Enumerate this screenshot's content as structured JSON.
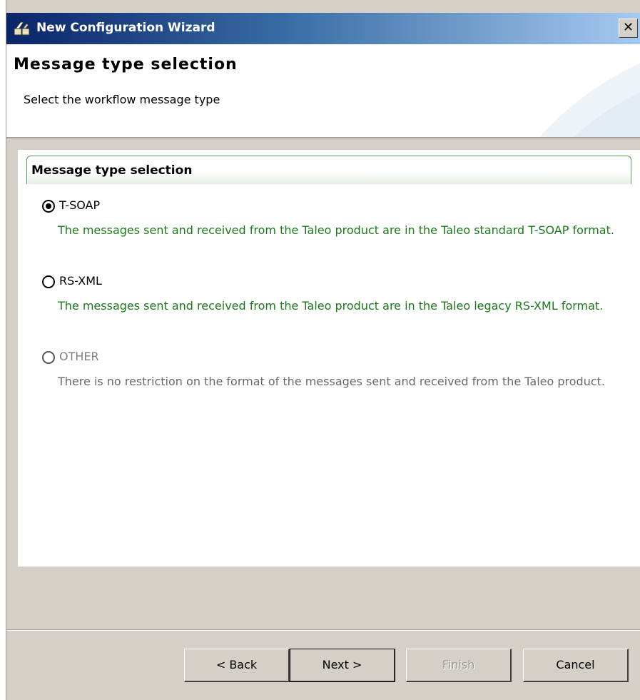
{
  "window": {
    "title": "New Configuration Wizard",
    "title_icon": "wizard-app-icon",
    "close_icon": "close-icon"
  },
  "header": {
    "title": "Message type selection",
    "subtitle": "Select the workflow message type"
  },
  "group": {
    "title": "Message type selection",
    "options": [
      {
        "label": "T-SOAP",
        "description": "The messages sent and received from the Taleo product are in the Taleo standard T-SOAP format.",
        "selected": true,
        "enabled": true
      },
      {
        "label": "RS-XML",
        "description": "The messages sent and received from the Taleo product are in the Taleo legacy RS-XML format.",
        "selected": false,
        "enabled": true
      },
      {
        "label": "OTHER",
        "description": "There is no restriction on the format of the messages sent and received from the Taleo product.",
        "selected": false,
        "enabled": false
      }
    ]
  },
  "buttons": {
    "back": "< Back",
    "next": "Next >",
    "finish": "Finish",
    "cancel": "Cancel"
  },
  "colors": {
    "title_bar_start": "#0a246a",
    "title_bar_end": "#a6caf0",
    "description_green": "#1a7a1a",
    "group_border": "#5aa05a",
    "dialog_face": "#d4d0c8"
  }
}
